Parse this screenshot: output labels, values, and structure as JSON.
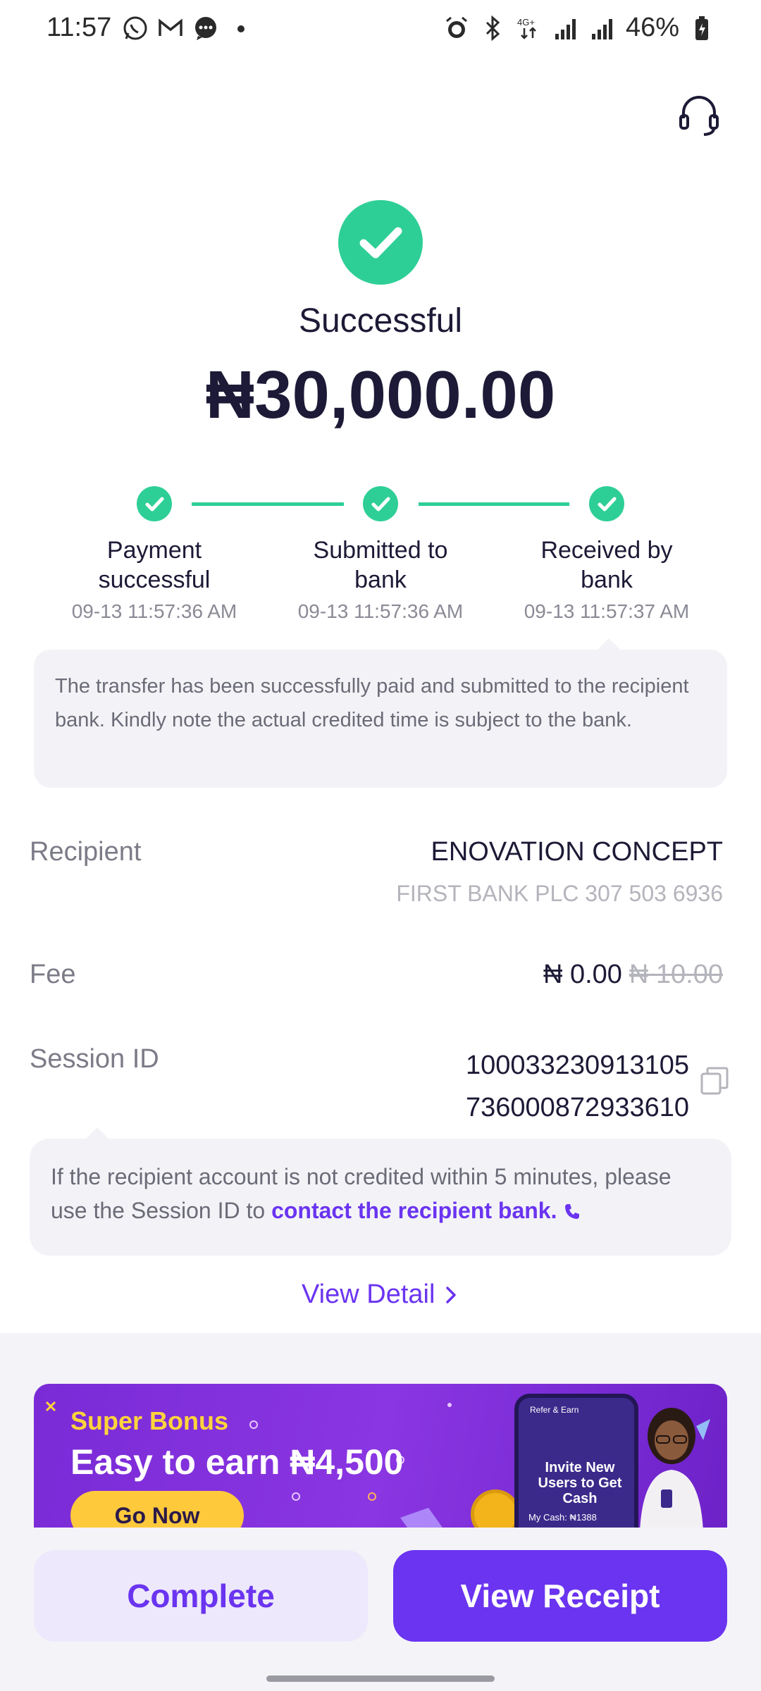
{
  "status_bar": {
    "time": "11:57",
    "battery": "46%",
    "network": "4G+"
  },
  "header": {
    "support_icon": "headset-icon"
  },
  "transaction": {
    "status": "Successful",
    "amount": "₦30,000.00"
  },
  "progress": {
    "steps": [
      {
        "label_line1": "Payment",
        "label_line2": "successful",
        "time": "09-13 11:57:36 AM"
      },
      {
        "label_line1": "Submitted to",
        "label_line2": "bank",
        "time": "09-13 11:57:36 AM"
      },
      {
        "label_line1": "Received by",
        "label_line2": "bank",
        "time": "09-13 11:57:37 AM"
      }
    ],
    "note": "The transfer has been successfully paid and submitted to the recipient bank. Kindly note the actual credited time is subject to the bank."
  },
  "details": {
    "recipient_label": "Recipient",
    "recipient_name": "ENOVATION CONCEPT",
    "recipient_bank": "FIRST BANK PLC 307 503 6936",
    "fee_label": "Fee",
    "fee_value": "₦ 0.00",
    "fee_original": "₦ 10.00",
    "session_label": "Session ID",
    "session_line1": "100033230913105",
    "session_line2": "736000872933610"
  },
  "session_note": {
    "text": "If the recipient account is not credited within 5 minutes, please use the Session ID to ",
    "link": "contact the recipient bank."
  },
  "view_detail": "View Detail",
  "banner": {
    "super": "Super Bonus",
    "headline": "Easy to earn ₦4,500",
    "button": "Go Now",
    "phone_header": "Refer & Earn",
    "phone_title": "Invite New Users to Get Cash",
    "phone_cash": "My Cash: ₦1388"
  },
  "actions": {
    "complete": "Complete",
    "view_receipt": "View Receipt"
  },
  "colors": {
    "success": "#2ecf96",
    "accent": "#6a34f0"
  }
}
